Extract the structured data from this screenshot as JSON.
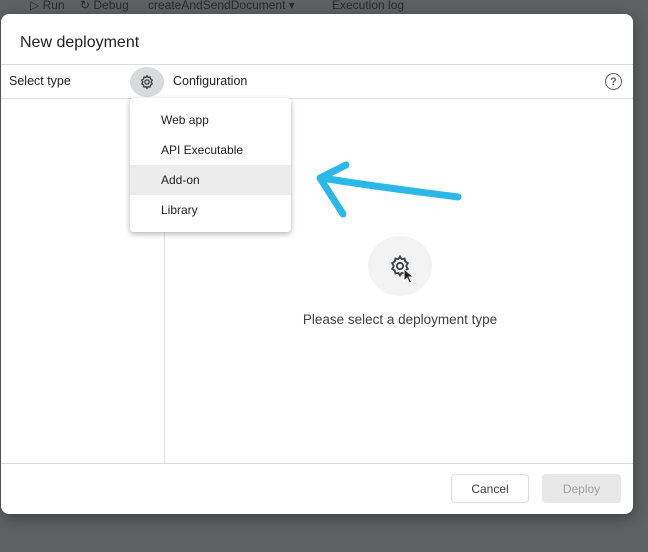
{
  "toolbar": {
    "run_label": "Run",
    "debug_label": "Debug",
    "function_name": "createAndSendDocument",
    "execution_log_label": "Execution log"
  },
  "dialog": {
    "title": "New deployment",
    "select_type_label": "Select type",
    "configuration_label": "Configuration",
    "help_symbol": "?",
    "menu": {
      "items": [
        {
          "label": "Web app"
        },
        {
          "label": "API Executable"
        },
        {
          "label": "Add-on",
          "highlighted": true
        },
        {
          "label": "Library"
        }
      ]
    },
    "placeholder_text": "Please select a deployment type",
    "cancel_label": "Cancel",
    "deploy_label": "Deploy"
  },
  "icons": {
    "gear": "gear-icon",
    "help": "help-icon",
    "pointer": "mouse-pointer-icon",
    "annotation": "hand-drawn-arrow"
  },
  "colors": {
    "overlay": "#5f6163",
    "annotation_arrow": "#2bb8e8",
    "menu_highlight": "#ececec"
  }
}
